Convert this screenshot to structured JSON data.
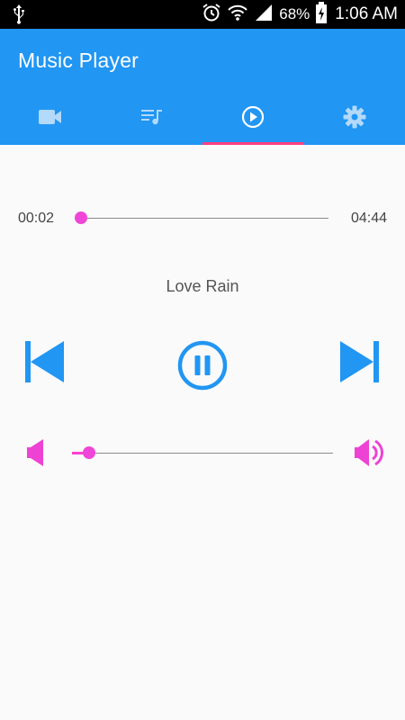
{
  "status_bar": {
    "battery": "68%",
    "time": "1:06 AM"
  },
  "app_bar": {
    "title": "Music Player",
    "tabs": [
      {
        "icon": "video-camera-icon",
        "active": false
      },
      {
        "icon": "playlist-icon",
        "active": false
      },
      {
        "icon": "play-circle-icon",
        "active": true
      },
      {
        "icon": "settings-gear-icon",
        "active": false
      }
    ]
  },
  "player": {
    "current_time": "00:02",
    "total_time": "04:44",
    "progress_fraction": 0.007,
    "song_title": "Love Rain",
    "state": "playing",
    "volume_fraction": 0.065
  },
  "colors": {
    "primary": "#2196f3",
    "accent": "#ff40d0",
    "tab_indicator": "#ff4081"
  }
}
